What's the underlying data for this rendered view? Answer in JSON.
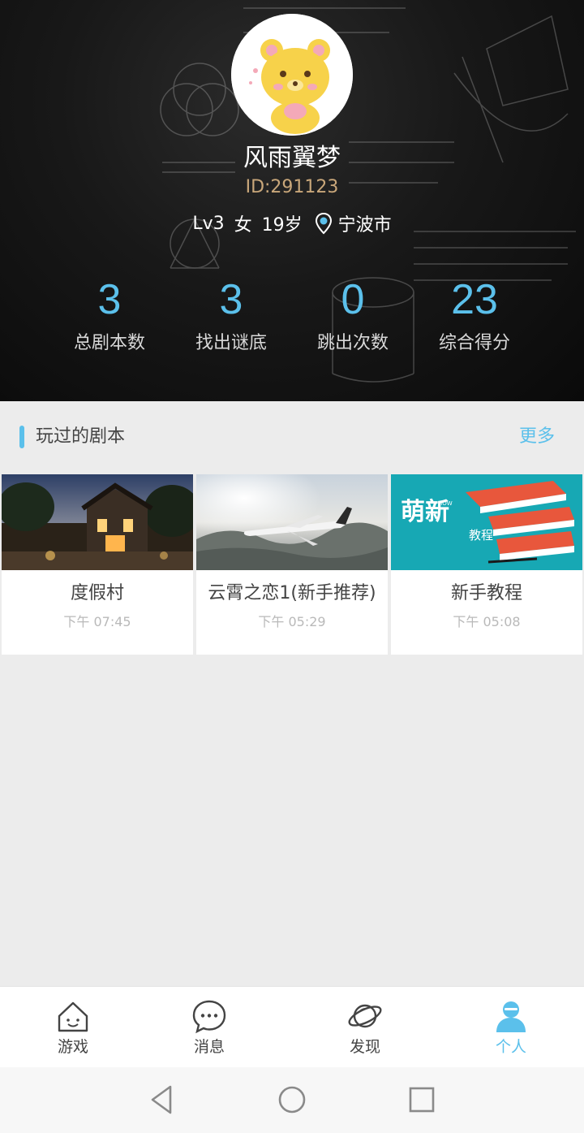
{
  "profile": {
    "nickname": "风雨翼梦",
    "id_text": "ID:291123",
    "level": "Lv3",
    "gender": "女",
    "age": "19岁",
    "city": "宁波市"
  },
  "stats": [
    {
      "value": "3",
      "label": "总剧本数"
    },
    {
      "value": "3",
      "label": "找出谜底"
    },
    {
      "value": "0",
      "label": "跳出次数"
    },
    {
      "value": "23",
      "label": "综合得分"
    }
  ],
  "section": {
    "title": "玩过的剧本",
    "more": "更多"
  },
  "cards": [
    {
      "title": "度假村",
      "time": "下午 07:45"
    },
    {
      "title": "云霄之恋1(新手推荐)",
      "time": "下午 05:29"
    },
    {
      "title": "新手教程",
      "time": "下午 05:08",
      "thumb_text_main": "萌新",
      "thumb_text_small": "教程",
      "thumb_text_tiny": "HOW"
    }
  ],
  "tabs": [
    {
      "label": "游戏",
      "icon": "house-icon"
    },
    {
      "label": "消息",
      "icon": "chat-icon"
    },
    {
      "label": "发现",
      "icon": "planet-icon"
    },
    {
      "label": "个人",
      "icon": "person-icon",
      "active": true
    }
  ],
  "colors": {
    "accent": "#5bc0eb",
    "id_gold": "#c9a77a",
    "background": "#ececec"
  }
}
